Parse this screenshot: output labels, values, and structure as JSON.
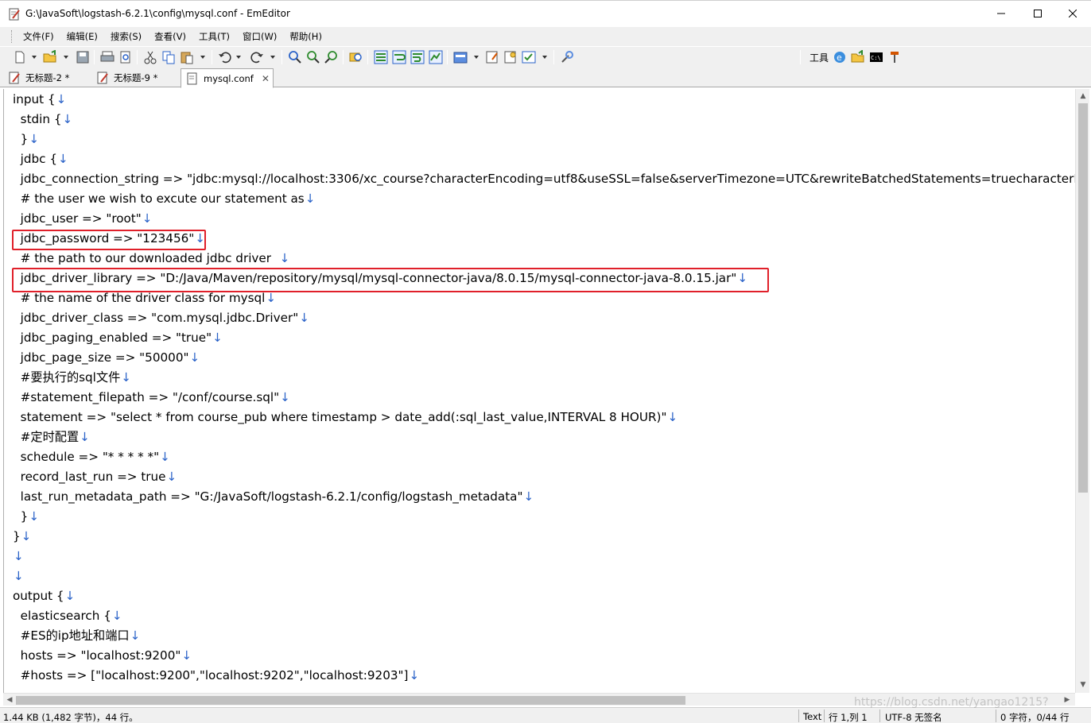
{
  "window": {
    "title": "G:\\JavaSoft\\logstash-6.2.1\\config\\mysql.conf - EmEditor"
  },
  "menu": [
    "文件(F)",
    "编辑(E)",
    "搜索(S)",
    "查看(V)",
    "工具(T)",
    "窗口(W)",
    "帮助(H)"
  ],
  "toolbar": {
    "tools_label": "工具"
  },
  "tabs": [
    {
      "label": "无标题-2 *",
      "active": false
    },
    {
      "label": "无标题-9 *",
      "active": false
    },
    {
      "label": "mysql.conf",
      "active": true
    }
  ],
  "editor": {
    "newline_glyph": "↓",
    "lines": [
      "input {",
      "  stdin {",
      "  }",
      "  jdbc {",
      "  jdbc_connection_string => \"jdbc:mysql://localhost:3306/xc_course?characterEncoding=utf8&useSSL=false&serverTimezone=UTC&rewriteBatchedStatements=truecharacterEn",
      "  # the user we wish to excute our statement as",
      "  jdbc_user => \"root\"",
      "  jdbc_password => \"123456\"",
      "  # the path to our downloaded jdbc driver  ",
      "  jdbc_driver_library => \"D:/Java/Maven/repository/mysql/mysql-connector-java/8.0.15/mysql-connector-java-8.0.15.jar\"",
      "  # the name of the driver class for mysql",
      "  jdbc_driver_class => \"com.mysql.jdbc.Driver\"",
      "  jdbc_paging_enabled => \"true\"",
      "  jdbc_page_size => \"50000\"",
      "  #要执行的sql文件",
      "  #statement_filepath => \"/conf/course.sql\"",
      "  statement => \"select * from course_pub where timestamp > date_add(:sql_last_value,INTERVAL 8 HOUR)\"",
      "  #定时配置",
      "  schedule => \"* * * * *\"",
      "  record_last_run => true",
      "  last_run_metadata_path => \"G:/JavaSoft/logstash-6.2.1/config/logstash_metadata\"",
      "  }",
      "}",
      "",
      "",
      "output {",
      "  elasticsearch {",
      "  #ES的ip地址和端口",
      "  hosts => \"localhost:9200\"",
      "  #hosts => [\"localhost:9200\",\"localhost:9202\",\"localhost:9203\"]"
    ],
    "highlight_colors": {
      "box": "#e0202a",
      "newline": "#2a62c8"
    }
  },
  "status": {
    "size": "1.44 KB (1,482 字节)，44 行。",
    "mode": "Text",
    "position": "行 1,列 1",
    "encoding": "UTF-8 无签名",
    "selection": "0 字符，0/44 行"
  },
  "watermark": "https://blog.csdn.net/yangao1215?"
}
